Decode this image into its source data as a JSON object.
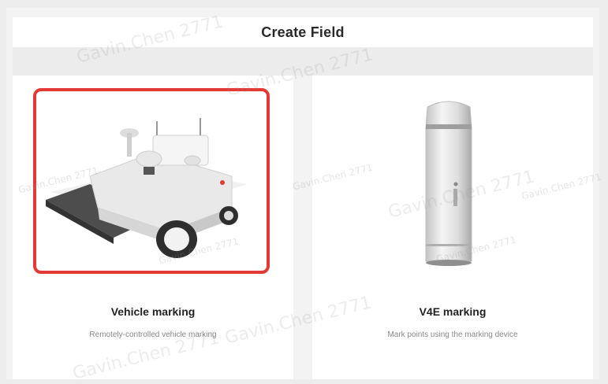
{
  "header": {
    "title": "Create Field"
  },
  "cards": [
    {
      "title": "Vehicle marking",
      "subtitle": "Remotely-controlled vehicle marking",
      "icon": "robot-vehicle-icon",
      "selected": true
    },
    {
      "title": "V4E marking",
      "subtitle": "Mark points using the marking device",
      "icon": "marking-device-icon",
      "selected": false
    }
  ],
  "watermark": "Gavin.Chen 2771",
  "colors": {
    "selection": "#e53935",
    "background": "#ededed",
    "card": "#ffffff"
  }
}
